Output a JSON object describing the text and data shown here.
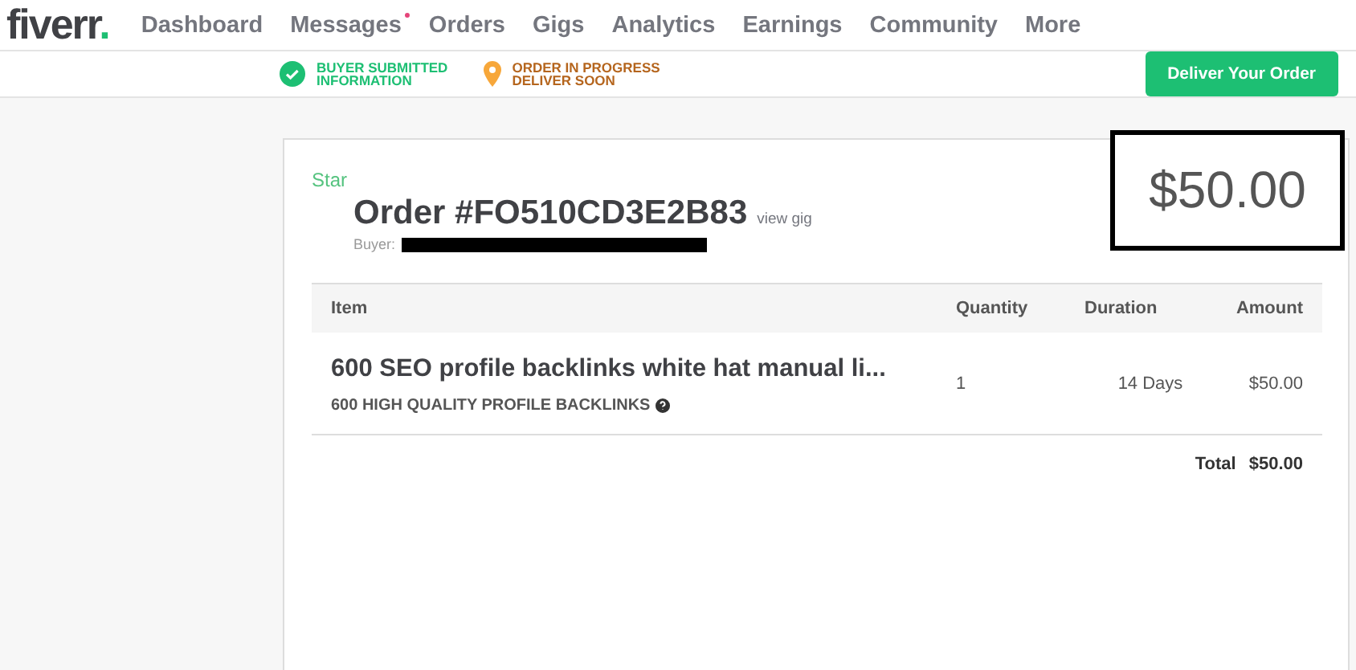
{
  "logo": {
    "text": "fiverr",
    "dot": "."
  },
  "nav": [
    {
      "label": "Dashboard",
      "unread": false
    },
    {
      "label": "Messages",
      "unread": true
    },
    {
      "label": "Orders",
      "unread": false
    },
    {
      "label": "Gigs",
      "unread": false
    },
    {
      "label": "Analytics",
      "unread": false
    },
    {
      "label": "Earnings",
      "unread": false
    },
    {
      "label": "Community",
      "unread": false
    },
    {
      "label": "More",
      "unread": false
    }
  ],
  "steps": [
    {
      "kind": "done",
      "lines": [
        "BUYER SUBMITTED",
        "INFORMATION"
      ]
    },
    {
      "kind": "current",
      "lines": [
        "ORDER IN PROGRESS",
        "DELIVER SOON"
      ]
    }
  ],
  "deliver_button": "Deliver Your Order",
  "order": {
    "tag": "Star",
    "title": "Order #FO510CD3E2B83",
    "view_gig": "view gig",
    "buyer_label": "Buyer:",
    "price": "$50.00"
  },
  "table": {
    "columns": [
      "Item",
      "Quantity",
      "Duration",
      "Amount"
    ],
    "rows": [
      {
        "title": "600 SEO profile backlinks white hat manual li...",
        "subtitle": "600 HIGH QUALITY PROFILE BACKLINKS",
        "quantity": "1",
        "duration": "14 Days",
        "amount": "$50.00"
      }
    ],
    "total_label": "Total",
    "total": "$50.00"
  }
}
